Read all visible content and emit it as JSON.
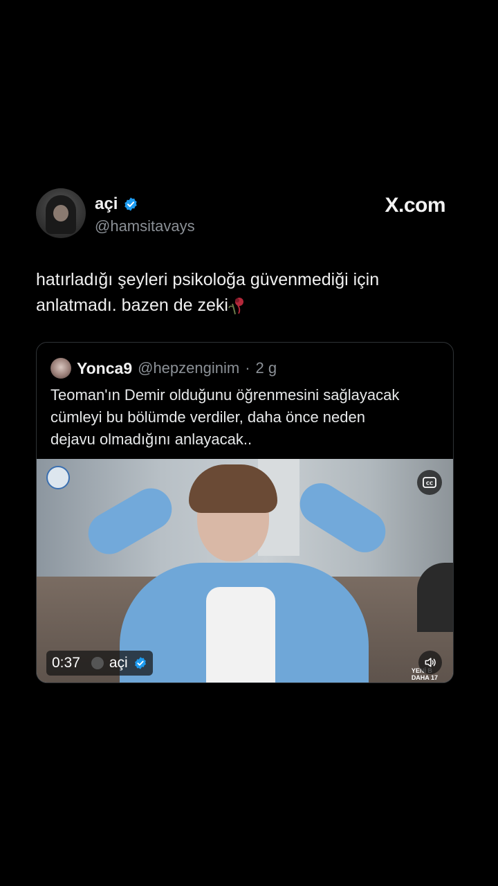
{
  "tweet": {
    "display_name": "açi",
    "handle": "@hamsitavays",
    "brand": "X.com",
    "text_line1": "hatırladığı şeyleri psikoloğa güvenmediği için",
    "text_line2": "anlatmadı. bazen de zeki",
    "accent_color": "#1d9bf0",
    "icons": {
      "verified": "verified-badge-icon",
      "rose": "wilted-rose-icon"
    }
  },
  "quote": {
    "display_name": "Yonca9",
    "handle": "@hepzenginim",
    "separator": "·",
    "time": "2 g",
    "text_line1": "Teoman'ın Demir olduğunu öğrenmesini sağlayacak",
    "text_line2": "cümleyi bu bölümde verdiler, daha önce neden",
    "text_line3": "dejavu olmadığını anlayacak.."
  },
  "video": {
    "timestamp": "0:37",
    "uploader": "açi",
    "watermark_line1": "YENİ B",
    "watermark_line2": "DAHA 17",
    "icons": {
      "captions": "cc-icon",
      "volume": "volume-icon"
    }
  }
}
